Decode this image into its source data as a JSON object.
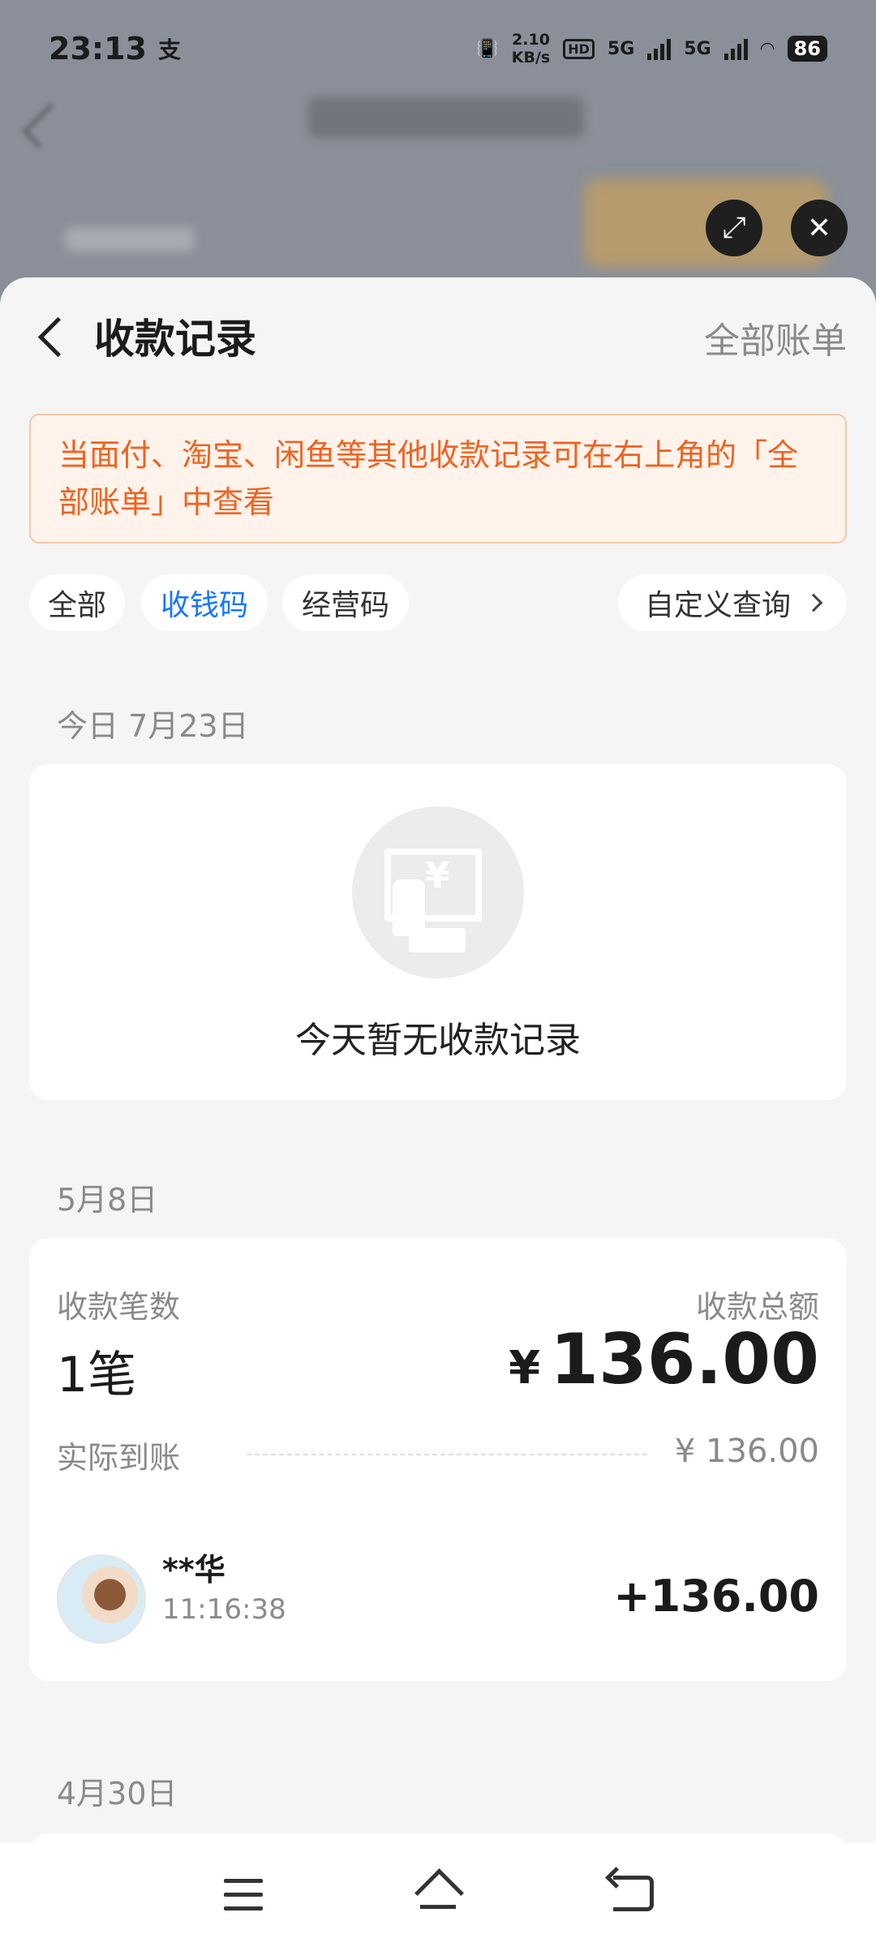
{
  "status_bar": {
    "time": "23:13",
    "app_icon": "支",
    "speed_value": "2.10",
    "speed_unit": "KB/s",
    "hd_label": "HD",
    "sim1_label": "5G",
    "sim2_label": "5G",
    "battery": "86"
  },
  "header": {
    "title": "收款记录",
    "all_bills": "全部账单"
  },
  "notice": {
    "text": "当面付、淘宝、闲鱼等其他收款记录可在右上角的「全部账单」中查看"
  },
  "filters": {
    "all": "全部",
    "qr_code": "收钱码",
    "business_code": "经营码",
    "custom_query": "自定义查询",
    "selected": "收钱码"
  },
  "today": {
    "date": "今日 7月23日",
    "empty_text": "今天暂无收款记录"
  },
  "may8": {
    "date": "5月8日",
    "count_label": "收款笔数",
    "count": "1笔",
    "total_label": "收款总额",
    "total_currency": "¥",
    "total": "136.00",
    "actual_label": "实际到账",
    "actual_value": "¥ 136.00",
    "transaction": {
      "name": "**华",
      "time": "11:16:38",
      "amount": "+136.00"
    }
  },
  "apr30": {
    "date": "4月30日"
  },
  "colors": {
    "accent": "#1677ff",
    "notice_text": "#f0631f",
    "notice_bg": "#fff3ec"
  }
}
